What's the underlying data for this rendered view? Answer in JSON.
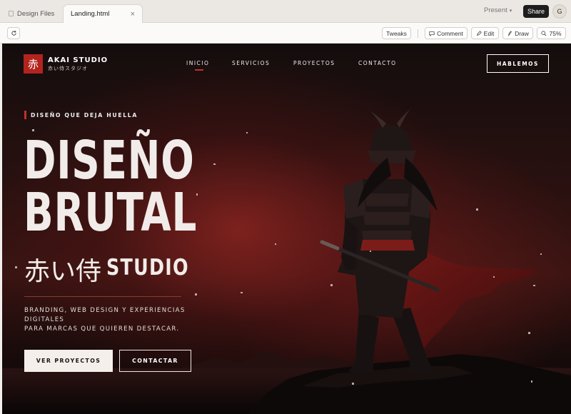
{
  "tabs": {
    "inactive_label": "Design Files",
    "active_label": "Landing.html",
    "close_glyph": "×"
  },
  "topbar": {
    "present_label": "Present",
    "share_label": "Share",
    "avatar_initial": "G"
  },
  "toolbar": {
    "tweaks_label": "Tweaks",
    "comment_label": "Comment",
    "edit_label": "Edit",
    "draw_label": "Draw",
    "zoom_label": "75%"
  },
  "site": {
    "logo_glyph": "赤",
    "brand": "AKAI STUDIO",
    "brand_sub": "赤い侍スタジオ",
    "nav": [
      "INICIO",
      "SERVICIOS",
      "PROYECTOS",
      "CONTACTO"
    ],
    "cta": "HABLEMOS",
    "eyebrow": "DISEÑO QUE DEJA HUELLA",
    "headline_1": "DISEÑO",
    "headline_2": "BRUTAL",
    "jp_title": "赤い侍",
    "jp_title_studio": "STUDIO",
    "desc_1": "BRANDING, WEB DESIGN Y EXPERIENCIAS",
    "desc_2": "DIGITALES",
    "desc_3": "PARA MARCAS QUE QUIEREN DESTACAR.",
    "primary_button": "VER PROYECTOS",
    "secondary_button": "CONTACTAR"
  },
  "icons": {
    "reload": "reload-icon",
    "comment": "comment-icon",
    "edit": "pencil-icon",
    "draw": "pen-icon",
    "zoom": "magnifier-icon"
  },
  "colors": {
    "accent_red": "#b3241f",
    "share_bg": "#1d1d1d"
  }
}
